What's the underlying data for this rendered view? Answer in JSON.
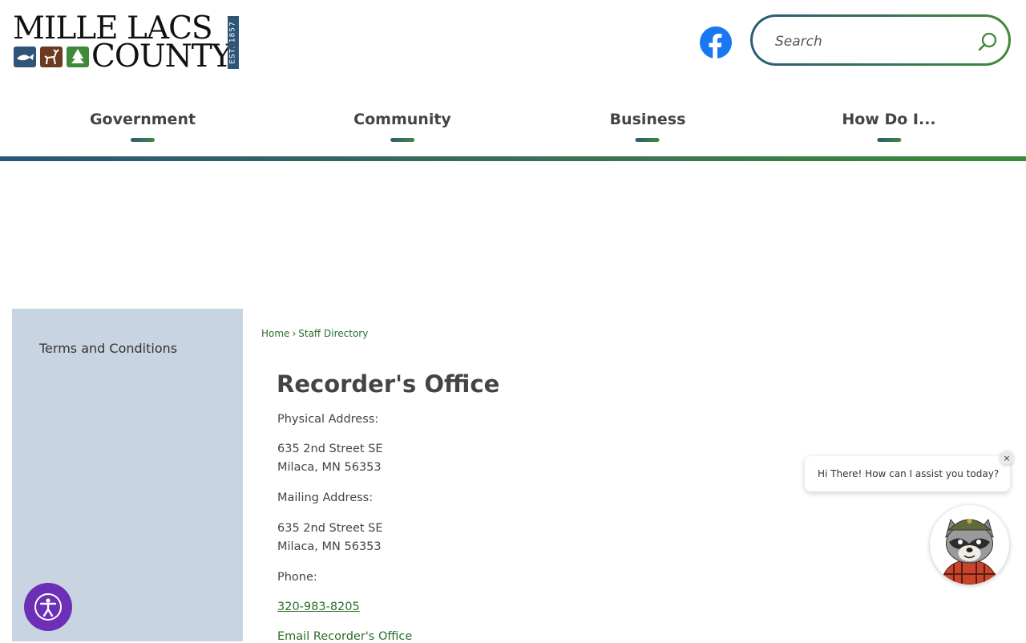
{
  "header": {
    "logo": {
      "line1": "MILLE LACS",
      "line2": "COUNTY",
      "established": "EST. 1857",
      "colors": {
        "fish": "#2e5578",
        "deer": "#6b3b1f",
        "tree": "#3f8a3a"
      }
    },
    "facebook_icon": "facebook-icon",
    "search": {
      "placeholder": "Search",
      "value": "",
      "icon": "search-icon"
    }
  },
  "nav": {
    "items": [
      {
        "label": "Government"
      },
      {
        "label": "Community"
      },
      {
        "label": "Business"
      },
      {
        "label": "How Do I..."
      }
    ],
    "accent_start": "#2e5578",
    "accent_end": "#3f8a3a"
  },
  "sidebar": {
    "items": [
      {
        "label": "Terms and Conditions"
      }
    ],
    "background": "#c9d4e2"
  },
  "breadcrumb": {
    "home": "Home",
    "separator": "›",
    "current": "Staff Directory"
  },
  "office": {
    "title": "Recorder's Office",
    "physical_label": "Physical Address:",
    "physical_line1": "635 2nd Street SE",
    "physical_line2": "Milaca, MN 56353",
    "mailing_label": "Mailing Address:",
    "mailing_line1": "635 2nd Street SE",
    "mailing_line2": "Milaca, MN 56353",
    "phone_label": "Phone:",
    "phone": "320-983-8205",
    "email_link": "Email Recorder's Office"
  },
  "chat": {
    "greeting": "Hi There! How can I assist you today?",
    "close_label": "×",
    "avatar_icon": "raccoon-avatar-icon"
  },
  "accessibility": {
    "icon": "accessibility-icon",
    "color": "#6d2fb5"
  }
}
